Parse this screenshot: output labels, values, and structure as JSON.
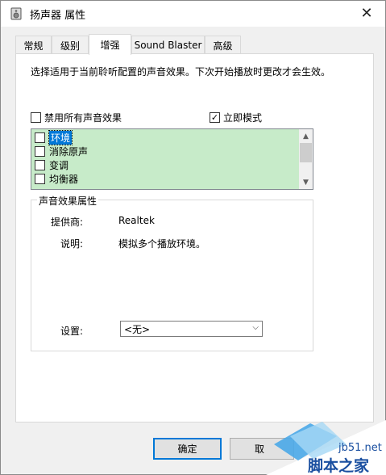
{
  "window": {
    "title": "扬声器 属性",
    "close_symbol": "✕"
  },
  "tabs": [
    {
      "label": "常规",
      "active": false
    },
    {
      "label": "级别",
      "active": false
    },
    {
      "label": "增强",
      "active": true
    },
    {
      "label": "Sound Blaster",
      "active": false
    },
    {
      "label": "高级",
      "active": false
    }
  ],
  "panel": {
    "description": "选择适用于当前聆听配置的声音效果。下次开始播放时更改才会生效。",
    "disable_all": {
      "label": "禁用所有声音效果",
      "checked": false
    },
    "immediate_mode": {
      "label": "立即模式",
      "checked": true
    },
    "effects": [
      {
        "label": "环境",
        "checked": false,
        "selected": true
      },
      {
        "label": "消除原声",
        "checked": false,
        "selected": false
      },
      {
        "label": "变调",
        "checked": false,
        "selected": false
      },
      {
        "label": "均衡器",
        "checked": false,
        "selected": false
      }
    ],
    "properties": {
      "title": "声音效果属性",
      "provider_label": "提供商:",
      "provider_value": "Realtek",
      "desc_label": "说明:",
      "desc_value": "模拟多个播放环境。",
      "settings_label": "设置:",
      "settings_value": "<无>"
    }
  },
  "buttons": {
    "ok": "确定",
    "cancel": "取"
  },
  "watermark": {
    "site": "jb51.net",
    "name": "脚本之家"
  },
  "icons": {
    "title": "speaker-icon",
    "close": "close-icon",
    "checkmark": "✓",
    "scroll_up": "▲",
    "scroll_down": "▼",
    "dropdown": "⌵"
  }
}
